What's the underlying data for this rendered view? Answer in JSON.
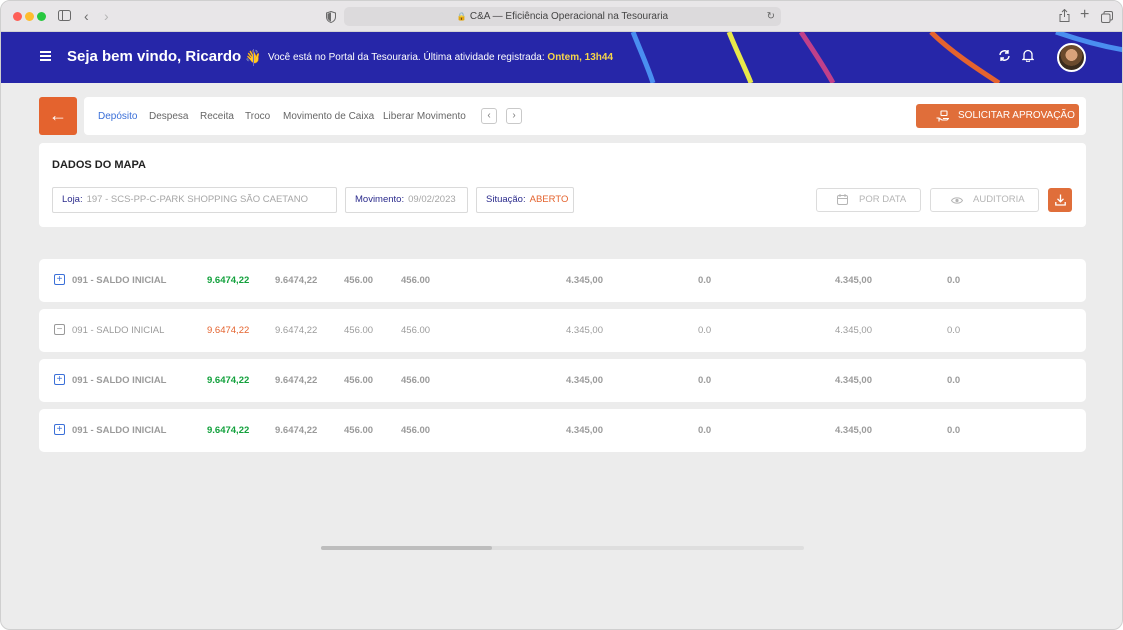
{
  "browser": {
    "url_title": "C&A — Eficiência Operacional na Tesouraria"
  },
  "header": {
    "welcome": "Seja bem vindo, Ricardo",
    "wave_emoji": "👋",
    "portal_text": "Você está no Portal da Tesouraria. Última atividade registrada:",
    "last_activity": "Ontem, 13h44",
    "colors": {
      "bar": "#2626a8",
      "accent": "#e4632e"
    }
  },
  "nav": {
    "tabs": [
      "Depósito",
      "Despesa",
      "Receita",
      "Troco",
      "Movimento de Caixa",
      "Liberar Movimento"
    ],
    "active_tab": "Depósito",
    "approve_label": "SOLICITAR APROVAÇÃO"
  },
  "map": {
    "title": "DADOS DO MAPA",
    "store_label": "Loja:",
    "store_value": "197 - SCS-PP-C-PARK SHOPPING SÃO CAETANO",
    "movement_label": "Movimento:",
    "movement_value": "09/02/2023",
    "status_label": "Situação:",
    "status_value": "ABERTO",
    "by_date_label": "POR DATA",
    "audit_label": "AUDITORIA"
  },
  "rows": [
    {
      "toggle": "+",
      "name": "091 - SALDO INICIAL",
      "c1": "9.6474,22",
      "c2": "9.6474,22",
      "c3": "456.00",
      "c4": "456.00",
      "c5": "4.345,00",
      "c6": "0.0",
      "c7": "4.345,00",
      "c8": "0.0"
    },
    {
      "toggle": "−",
      "name": "091 - SALDO INICIAL",
      "c1": "9.6474,22",
      "c2": "9.6474,22",
      "c3": "456.00",
      "c4": "456.00",
      "c5": "4.345,00",
      "c6": "0.0",
      "c7": "4.345,00",
      "c8": "0.0"
    },
    {
      "toggle": "+",
      "name": "091 - SALDO INICIAL",
      "c1": "9.6474,22",
      "c2": "9.6474,22",
      "c3": "456.00",
      "c4": "456.00",
      "c5": "4.345,00",
      "c6": "0.0",
      "c7": "4.345,00",
      "c8": "0.0"
    },
    {
      "toggle": "+",
      "name": "091 - SALDO INICIAL",
      "c1": "9.6474,22",
      "c2": "9.6474,22",
      "c3": "456.00",
      "c4": "456.00",
      "c5": "4.345,00",
      "c6": "0.0",
      "c7": "4.345,00",
      "c8": "0.0"
    }
  ],
  "scroll": {
    "position": 0.35
  }
}
